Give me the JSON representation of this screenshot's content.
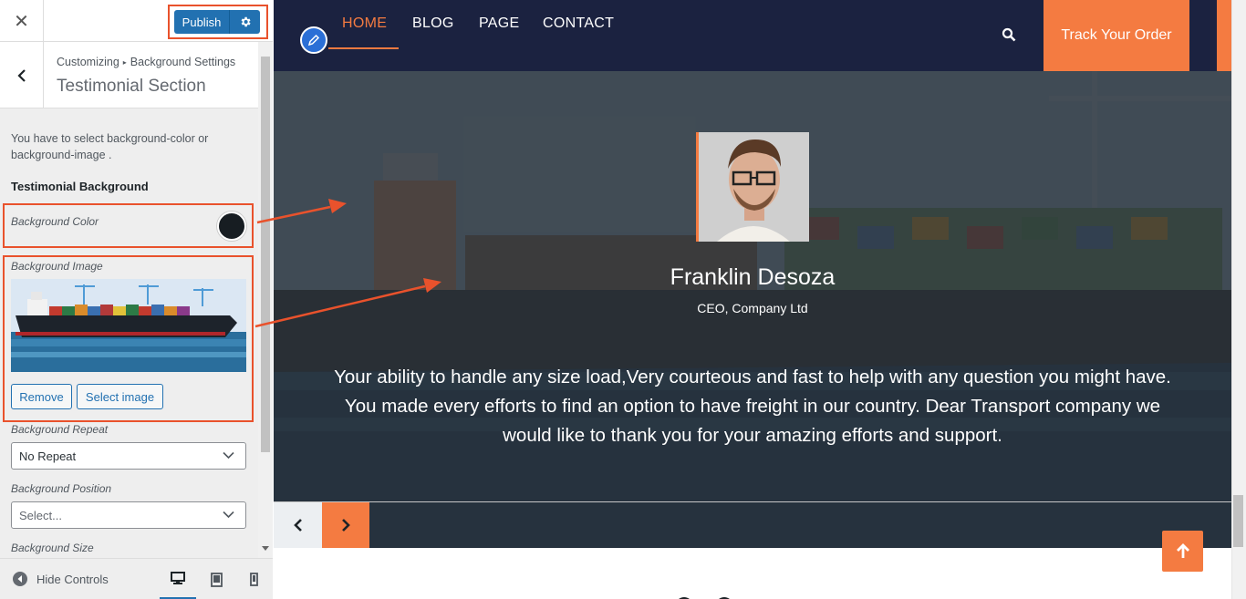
{
  "customizer": {
    "close_glyph": "✕",
    "publish_label": "Publish",
    "breadcrumb_root": "Customizing",
    "breadcrumb_sep": "▸",
    "breadcrumb_parent": "Background Settings",
    "section_title": "Testimonial Section",
    "description": "You have to select background-color or background-image .",
    "group_title": "Testimonial Background",
    "bg_color_label": "Background Color",
    "bg_color_value": "#171d22",
    "bg_image_label": "Background Image",
    "remove_label": "Remove",
    "select_image_label": "Select image",
    "bg_repeat_label": "Background Repeat",
    "bg_repeat_value": "No Repeat",
    "bg_position_label": "Background Position",
    "bg_position_value": "Select...",
    "bg_size_label": "Background Size",
    "hide_controls_label": "Hide Controls"
  },
  "site": {
    "nav": [
      "HOME",
      "BLOG",
      "PAGE",
      "CONTACT"
    ],
    "active_nav": "HOME",
    "track_label": "Track Your Order",
    "testimonial": {
      "name": "Franklin Desoza",
      "role": "CEO, Company Ltd",
      "quote": "Your ability to handle any size load,Very courteous and fast to help with any question you might have. You made every efforts to find an option to have freight in our country. Dear Transport company we would like to thank you for your amazing efforts and support."
    }
  },
  "colors": {
    "accent": "#f47b41",
    "nav_bg": "#1b2240",
    "publish_blue": "#2271b1",
    "highlight": "#e9522c"
  },
  "icons": [
    "close-icon",
    "gear-icon",
    "back-chevron-icon",
    "color-swatch",
    "chevron-down-icon",
    "hide-controls-icon",
    "desktop-icon",
    "tablet-icon",
    "mobile-icon",
    "pencil-logo-icon",
    "search-icon",
    "arrow-left-icon",
    "arrow-right-icon",
    "arrow-up-icon"
  ]
}
